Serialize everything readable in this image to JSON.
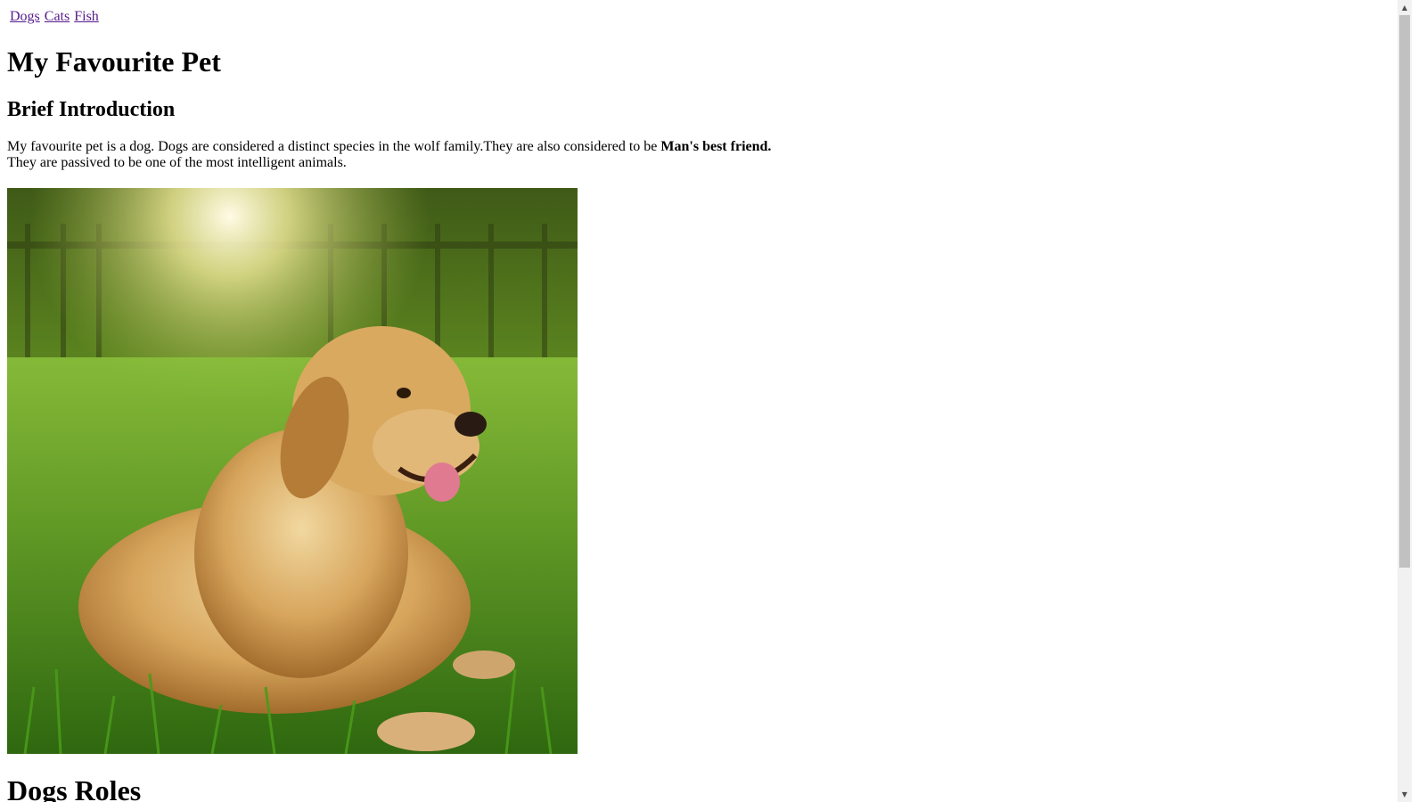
{
  "nav": {
    "links": [
      "Dogs",
      "Cats",
      "Fish"
    ]
  },
  "page_title": "My Favourite Pet",
  "intro_heading": "Brief Introduction",
  "intro": {
    "text_before_bold": "My favourite pet is a dog. Dogs are considered a distinct species in the wolf family.They are also considered to be ",
    "bold_text": "Man's best friend.",
    "text_after_bold": "They are passived to be one of the most intelligent animals."
  },
  "photo": {
    "subject": "golden retriever lying in grass"
  },
  "section_heading": "Dogs Roles",
  "colors": {
    "link_visited": "#551a8b",
    "text": "#000000",
    "scrollbar_track": "#f1f1f1",
    "scrollbar_thumb": "#c1c1c1"
  }
}
